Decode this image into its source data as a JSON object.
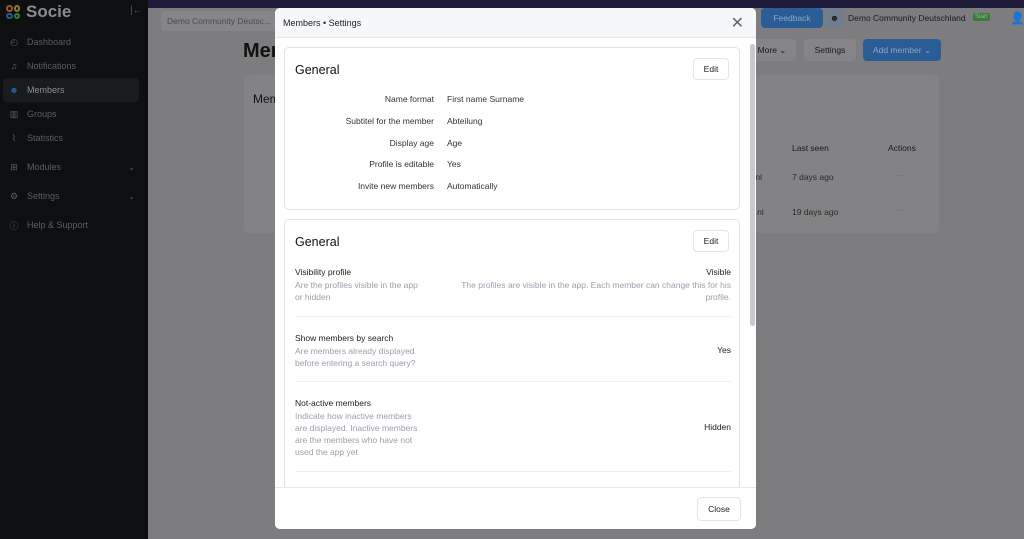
{
  "sidebar": {
    "brand": "Socie",
    "items": [
      {
        "label": "Dashboard",
        "icon": "gauge-icon"
      },
      {
        "label": "Notifications",
        "icon": "bell-icon"
      },
      {
        "label": "Members",
        "icon": "users-icon",
        "active": true
      },
      {
        "label": "Groups",
        "icon": "groups-icon"
      },
      {
        "label": "Statistics",
        "icon": "chart-icon"
      },
      {
        "label": "Modules",
        "icon": "grid-icon",
        "expandable": true
      },
      {
        "label": "Settings",
        "icon": "gear-icon",
        "expandable": true
      },
      {
        "label": "Help & Support",
        "icon": "help-icon"
      }
    ]
  },
  "header": {
    "community_select": "Demo Community Deutsc...",
    "feedback": "Feedback",
    "community_name": "Demo Community Deutschland",
    "plan_badge": "Start"
  },
  "page": {
    "title": "Members",
    "more": "More",
    "settings": "Settings",
    "add_member": "Add member",
    "card_title": "Members",
    "columns": {
      "last_seen": "Last seen",
      "actions": "Actions"
    },
    "rows": [
      {
        "email_tail": ".nl",
        "last_seen": "7 days ago",
        "actions": "···"
      },
      {
        "email_tail": "e.nl",
        "last_seen": "19 days ago",
        "actions": "···"
      }
    ]
  },
  "modal": {
    "title": "Members • Settings",
    "close": "Close",
    "card1": {
      "title": "General",
      "edit": "Edit",
      "fields": [
        {
          "k": "Name format",
          "v": "First name Surname"
        },
        {
          "k": "Subtitel for the member",
          "v": "Abteilung"
        },
        {
          "k": "Display age",
          "v": "Age"
        },
        {
          "k": "Profile is editable",
          "v": "Yes"
        },
        {
          "k": "Invite new members",
          "v": "Automatically"
        }
      ]
    },
    "card2": {
      "title": "General",
      "edit": "Edit",
      "settings": [
        {
          "title": "Visibility profile",
          "desc": "Are the profiles visible in the app or hidden",
          "value": "Visible",
          "value_desc": "The profiles are visible in the app. Each member can change this for his profile."
        },
        {
          "title": "Show members by search",
          "desc": "Are members already displayed before entering a search query?",
          "value": "Yes"
        },
        {
          "title": "Not-active members",
          "desc": "Indicate how inactive members are displayed. Inactive members are the members who have not used the app yet",
          "value": "Hidden"
        }
      ]
    }
  },
  "colors": {
    "accent": "#2f6fb8",
    "sidebar": "#0e0f11",
    "badge": "#3a9a3a"
  }
}
